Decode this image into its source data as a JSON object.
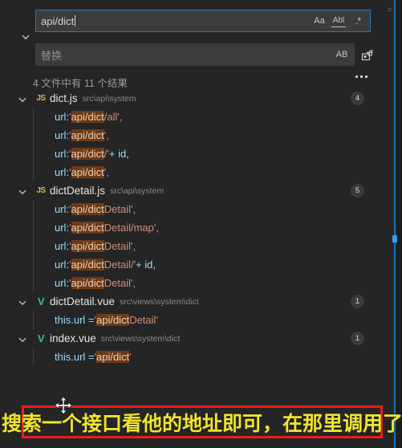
{
  "app": {
    "name": "vscode-search-panel",
    "theme_bg": "#252526",
    "accent": "#1177bb"
  },
  "search": {
    "query": "api/dict",
    "replace_placeholder": "替换",
    "options": [
      {
        "name": "match-case-icon",
        "label": "Aa"
      },
      {
        "name": "match-whole-word-icon",
        "label": "Abl"
      },
      {
        "name": "use-regex-icon",
        "label": ".*"
      }
    ],
    "replace_option": {
      "name": "preserve-case-icon",
      "label": "AB"
    },
    "replace_all_label": "替换全部",
    "toggle_label": "切换替换",
    "more_actions_label": "..."
  },
  "results": {
    "summary": "4 文件中有 11 个结果",
    "files": [
      {
        "icon": "js",
        "icon_label": "JS",
        "name": "dict.js",
        "path": "src\\api\\system",
        "count": "4",
        "matches": [
          {
            "prefix": "url: ",
            "quote_open": "'",
            "hl": "api/dict",
            "rest": "/all",
            "quote_close": "',",
            "tail": ""
          },
          {
            "prefix": "url: ",
            "quote_open": "'",
            "hl": "api/dict",
            "rest": "",
            "quote_close": "',",
            "tail": ""
          },
          {
            "prefix": "url: ",
            "quote_open": "'",
            "hl": "api/dict",
            "rest": "/",
            "quote_close": "'",
            "tail": " + id,"
          },
          {
            "prefix": "url: ",
            "quote_open": "'",
            "hl": "api/dict",
            "rest": "",
            "quote_close": "',",
            "tail": ""
          }
        ]
      },
      {
        "icon": "js",
        "icon_label": "JS",
        "name": "dictDetail.js",
        "path": "src\\api\\system",
        "count": "5",
        "matches": [
          {
            "prefix": "url: ",
            "quote_open": "'",
            "hl": "api/dict",
            "rest": "Detail",
            "quote_close": "',",
            "tail": ""
          },
          {
            "prefix": "url: ",
            "quote_open": "'",
            "hl": "api/dict",
            "rest": "Detail/map",
            "quote_close": "',",
            "tail": ""
          },
          {
            "prefix": "url: ",
            "quote_open": "'",
            "hl": "api/dict",
            "rest": "Detail",
            "quote_close": "',",
            "tail": ""
          },
          {
            "prefix": "url: ",
            "quote_open": "'",
            "hl": "api/dict",
            "rest": "Detail/",
            "quote_close": "'",
            "tail": " + id,"
          },
          {
            "prefix": "url: ",
            "quote_open": "'",
            "hl": "api/dict",
            "rest": "Detail",
            "quote_close": "',",
            "tail": ""
          }
        ]
      },
      {
        "icon": "vue",
        "icon_label": "V",
        "name": "dictDetail.vue",
        "path": "src\\views\\system\\dict",
        "count": "1",
        "matches": [
          {
            "prefix": "this.url = ",
            "quote_open": "'",
            "hl": "api/dict",
            "rest": "Detail",
            "quote_close": "'",
            "tail": ""
          }
        ]
      },
      {
        "icon": "vue",
        "icon_label": "V",
        "name": "index.vue",
        "path": "src\\views\\system\\dict",
        "count": "1",
        "matches": [
          {
            "prefix": "this.url = ",
            "quote_open": "'",
            "hl": "api/dict",
            "rest": "",
            "quote_close": "'",
            "tail": ""
          }
        ]
      }
    ]
  },
  "annotation": {
    "text": "搜索一个接口看他的地址即可，在那里调用了",
    "border_color": "#ee1c1c",
    "text_color": "#f2e52a"
  },
  "cursor": {
    "name": "move-cursor"
  }
}
